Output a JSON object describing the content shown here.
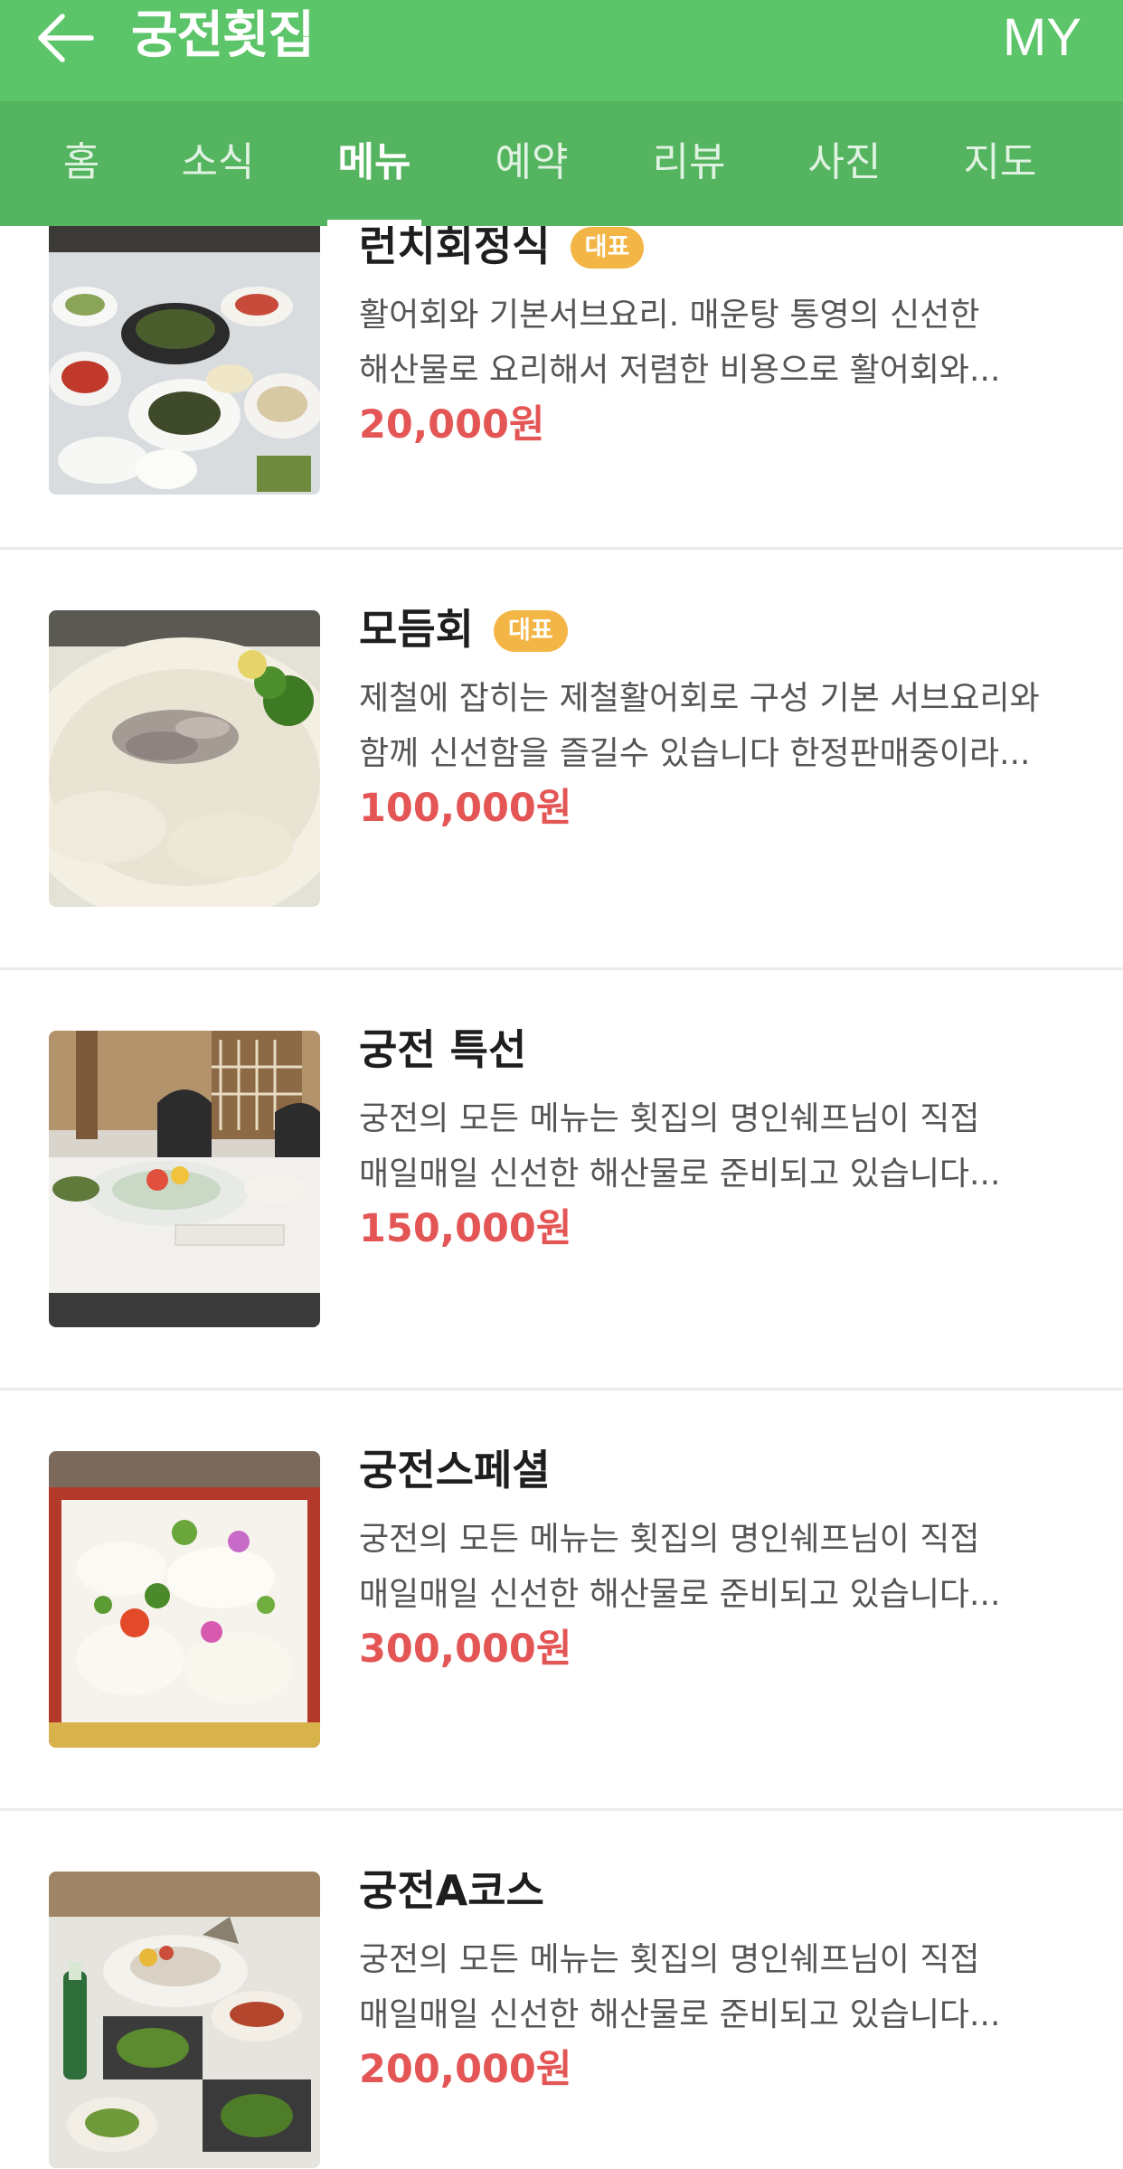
{
  "header": {
    "title": "궁전횟집",
    "my_label": "MY"
  },
  "tabs": [
    {
      "label": "홈"
    },
    {
      "label": "소식"
    },
    {
      "label": "메뉴"
    },
    {
      "label": "예약"
    },
    {
      "label": "리뷰"
    },
    {
      "label": "사진"
    },
    {
      "label": "지도"
    }
  ],
  "active_tab": "메뉴",
  "menu": {
    "items": [
      {
        "name": "런치회정식",
        "badge": "대표",
        "desc_line1": "활어회와 기본서브요리. 매운탕 통영의 신선한",
        "desc_line2": "해산물로 요리해서 저렴한 비용으로 활어회와...",
        "price": "20,000원",
        "image": "banquet-table-photo"
      },
      {
        "name": "모듬회",
        "badge": "대표",
        "desc_line1": "제철에 잡히는 제철활어회로 구성 기본 서브요리와",
        "desc_line2": "함께 신선함을 즐길수 있습니다 한정판매중이라...",
        "price": "100,000원",
        "image": "sashimi-platter-photo"
      },
      {
        "name": "궁전 특선",
        "badge": "",
        "desc_line1": "궁전의 모든 메뉴는 횟집의 명인쉐프님이 직접",
        "desc_line2": "매일매일 신선한 해산물로 준비되고 있습니다...",
        "price": "150,000원",
        "image": "dining-room-photo"
      },
      {
        "name": "궁전스페셜",
        "badge": "",
        "desc_line1": "궁전의 모든 메뉴는 횟집의 명인쉐프님이 직접",
        "desc_line2": "매일매일 신선한 해산물로 준비되고 있습니다...",
        "price": "300,000원",
        "image": "special-platter-photo"
      },
      {
        "name": "궁전A코스",
        "badge": "",
        "desc_line1": "궁전의 모든 메뉴는 횟집의 명인쉐프님이 직접",
        "desc_line2": "매일매일 신선한 해산물로 준비되고 있습니다...",
        "price": "200,000원",
        "image": "course-table-photo"
      }
    ]
  },
  "colors": {
    "header_green": "#5cc56a",
    "tabbar_green": "#55b45f",
    "price_red": "#e45656",
    "badge_orange": "#f3b545"
  },
  "icons": {
    "back": "arrow-left-icon"
  }
}
